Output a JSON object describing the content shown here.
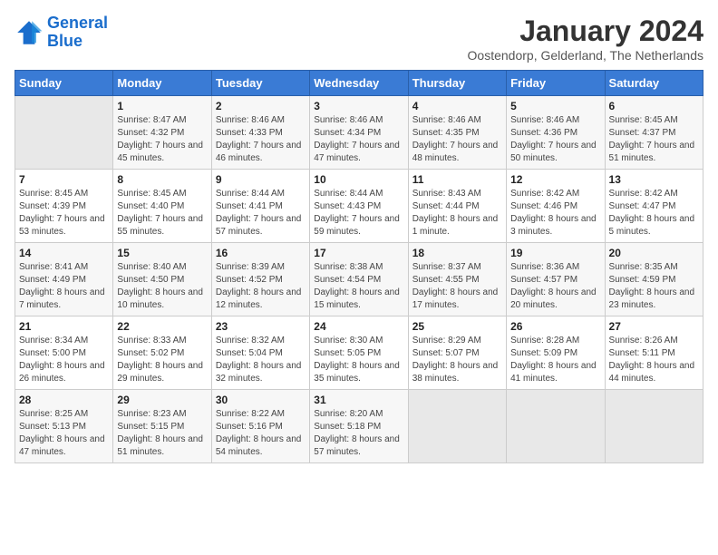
{
  "header": {
    "logo_line1": "General",
    "logo_line2": "Blue",
    "month": "January 2024",
    "location": "Oostendorp, Gelderland, The Netherlands"
  },
  "weekdays": [
    "Sunday",
    "Monday",
    "Tuesday",
    "Wednesday",
    "Thursday",
    "Friday",
    "Saturday"
  ],
  "weeks": [
    [
      {
        "day": "",
        "empty": true
      },
      {
        "day": "1",
        "sunrise": "8:47 AM",
        "sunset": "4:32 PM",
        "daylight": "7 hours and 45 minutes."
      },
      {
        "day": "2",
        "sunrise": "8:46 AM",
        "sunset": "4:33 PM",
        "daylight": "7 hours and 46 minutes."
      },
      {
        "day": "3",
        "sunrise": "8:46 AM",
        "sunset": "4:34 PM",
        "daylight": "7 hours and 47 minutes."
      },
      {
        "day": "4",
        "sunrise": "8:46 AM",
        "sunset": "4:35 PM",
        "daylight": "7 hours and 48 minutes."
      },
      {
        "day": "5",
        "sunrise": "8:46 AM",
        "sunset": "4:36 PM",
        "daylight": "7 hours and 50 minutes."
      },
      {
        "day": "6",
        "sunrise": "8:45 AM",
        "sunset": "4:37 PM",
        "daylight": "7 hours and 51 minutes."
      }
    ],
    [
      {
        "day": "7",
        "sunrise": "8:45 AM",
        "sunset": "4:39 PM",
        "daylight": "7 hours and 53 minutes."
      },
      {
        "day": "8",
        "sunrise": "8:45 AM",
        "sunset": "4:40 PM",
        "daylight": "7 hours and 55 minutes."
      },
      {
        "day": "9",
        "sunrise": "8:44 AM",
        "sunset": "4:41 PM",
        "daylight": "7 hours and 57 minutes."
      },
      {
        "day": "10",
        "sunrise": "8:44 AM",
        "sunset": "4:43 PM",
        "daylight": "7 hours and 59 minutes."
      },
      {
        "day": "11",
        "sunrise": "8:43 AM",
        "sunset": "4:44 PM",
        "daylight": "8 hours and 1 minute."
      },
      {
        "day": "12",
        "sunrise": "8:42 AM",
        "sunset": "4:46 PM",
        "daylight": "8 hours and 3 minutes."
      },
      {
        "day": "13",
        "sunrise": "8:42 AM",
        "sunset": "4:47 PM",
        "daylight": "8 hours and 5 minutes."
      }
    ],
    [
      {
        "day": "14",
        "sunrise": "8:41 AM",
        "sunset": "4:49 PM",
        "daylight": "8 hours and 7 minutes."
      },
      {
        "day": "15",
        "sunrise": "8:40 AM",
        "sunset": "4:50 PM",
        "daylight": "8 hours and 10 minutes."
      },
      {
        "day": "16",
        "sunrise": "8:39 AM",
        "sunset": "4:52 PM",
        "daylight": "8 hours and 12 minutes."
      },
      {
        "day": "17",
        "sunrise": "8:38 AM",
        "sunset": "4:54 PM",
        "daylight": "8 hours and 15 minutes."
      },
      {
        "day": "18",
        "sunrise": "8:37 AM",
        "sunset": "4:55 PM",
        "daylight": "8 hours and 17 minutes."
      },
      {
        "day": "19",
        "sunrise": "8:36 AM",
        "sunset": "4:57 PM",
        "daylight": "8 hours and 20 minutes."
      },
      {
        "day": "20",
        "sunrise": "8:35 AM",
        "sunset": "4:59 PM",
        "daylight": "8 hours and 23 minutes."
      }
    ],
    [
      {
        "day": "21",
        "sunrise": "8:34 AM",
        "sunset": "5:00 PM",
        "daylight": "8 hours and 26 minutes."
      },
      {
        "day": "22",
        "sunrise": "8:33 AM",
        "sunset": "5:02 PM",
        "daylight": "8 hours and 29 minutes."
      },
      {
        "day": "23",
        "sunrise": "8:32 AM",
        "sunset": "5:04 PM",
        "daylight": "8 hours and 32 minutes."
      },
      {
        "day": "24",
        "sunrise": "8:30 AM",
        "sunset": "5:05 PM",
        "daylight": "8 hours and 35 minutes."
      },
      {
        "day": "25",
        "sunrise": "8:29 AM",
        "sunset": "5:07 PM",
        "daylight": "8 hours and 38 minutes."
      },
      {
        "day": "26",
        "sunrise": "8:28 AM",
        "sunset": "5:09 PM",
        "daylight": "8 hours and 41 minutes."
      },
      {
        "day": "27",
        "sunrise": "8:26 AM",
        "sunset": "5:11 PM",
        "daylight": "8 hours and 44 minutes."
      }
    ],
    [
      {
        "day": "28",
        "sunrise": "8:25 AM",
        "sunset": "5:13 PM",
        "daylight": "8 hours and 47 minutes."
      },
      {
        "day": "29",
        "sunrise": "8:23 AM",
        "sunset": "5:15 PM",
        "daylight": "8 hours and 51 minutes."
      },
      {
        "day": "30",
        "sunrise": "8:22 AM",
        "sunset": "5:16 PM",
        "daylight": "8 hours and 54 minutes."
      },
      {
        "day": "31",
        "sunrise": "8:20 AM",
        "sunset": "5:18 PM",
        "daylight": "8 hours and 57 minutes."
      },
      {
        "day": "",
        "empty": true
      },
      {
        "day": "",
        "empty": true
      },
      {
        "day": "",
        "empty": true
      }
    ]
  ]
}
